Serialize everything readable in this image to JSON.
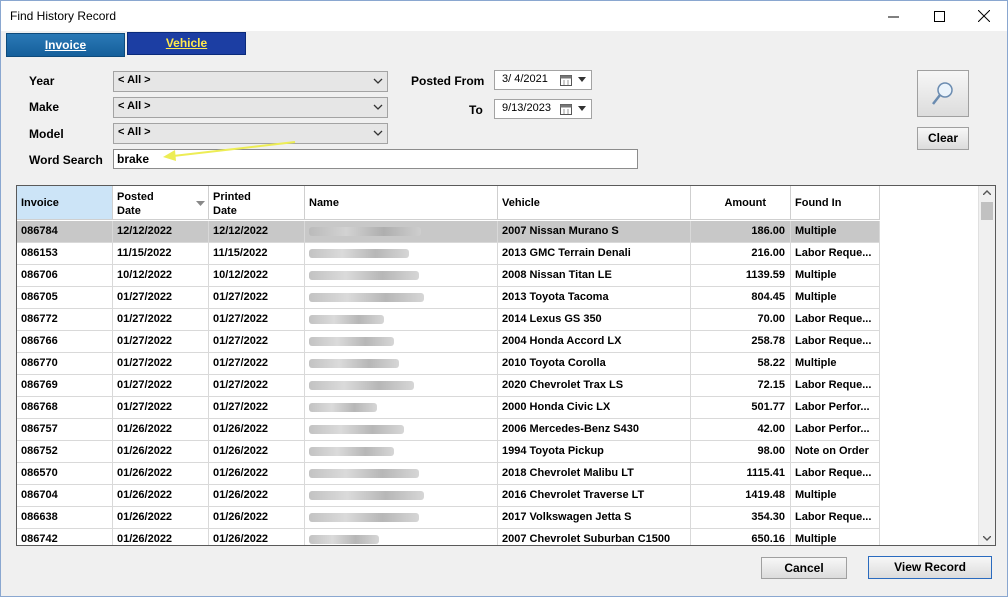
{
  "window": {
    "title": "Find History Record"
  },
  "tabs": [
    {
      "label": "Invoice",
      "active": false
    },
    {
      "label": "Vehicle",
      "active": true
    }
  ],
  "filters": {
    "year_label": "Year",
    "year_value": "< All >",
    "make_label": "Make",
    "make_value": "< All >",
    "model_label": "Model",
    "model_value": "< All >",
    "word_search_label": "Word Search",
    "word_search_value": "brake",
    "posted_from_label": "Posted From",
    "posted_from_value": "3/  4/2021",
    "to_label": "To",
    "to_value": "9/13/2023"
  },
  "buttons": {
    "clear": "Clear",
    "cancel": "Cancel",
    "view_record": "View Record"
  },
  "grid": {
    "columns": [
      {
        "key": "invoice",
        "label": "Invoice",
        "sub": ""
      },
      {
        "key": "posted",
        "label": "Posted",
        "sub": "Date"
      },
      {
        "key": "printed",
        "label": "Printed",
        "sub": "Date"
      },
      {
        "key": "name",
        "label": "Name",
        "sub": ""
      },
      {
        "key": "vehicle",
        "label": "Vehicle",
        "sub": ""
      },
      {
        "key": "amount",
        "label": "Amount",
        "sub": ""
      },
      {
        "key": "found",
        "label": "Found In",
        "sub": ""
      }
    ],
    "rows": [
      {
        "invoice": "086784",
        "posted": "12/12/2022",
        "printed": "12/12/2022",
        "vehicle": "2007 Nissan Murano S",
        "amount": "186.00",
        "found": "Multiple"
      },
      {
        "invoice": "086153",
        "posted": "11/15/2022",
        "printed": "11/15/2022",
        "vehicle": "2013 GMC Terrain Denali",
        "amount": "216.00",
        "found": "Labor Reque..."
      },
      {
        "invoice": "086706",
        "posted": "10/12/2022",
        "printed": "10/12/2022",
        "vehicle": "2008 Nissan Titan LE",
        "amount": "1139.59",
        "found": "Multiple"
      },
      {
        "invoice": "086705",
        "posted": "01/27/2022",
        "printed": "01/27/2022",
        "vehicle": "2013 Toyota Tacoma",
        "amount": "804.45",
        "found": "Multiple"
      },
      {
        "invoice": "086772",
        "posted": "01/27/2022",
        "printed": "01/27/2022",
        "vehicle": "2014 Lexus GS 350",
        "amount": "70.00",
        "found": "Labor Reque..."
      },
      {
        "invoice": "086766",
        "posted": "01/27/2022",
        "printed": "01/27/2022",
        "vehicle": "2004 Honda Accord LX",
        "amount": "258.78",
        "found": "Labor Reque..."
      },
      {
        "invoice": "086770",
        "posted": "01/27/2022",
        "printed": "01/27/2022",
        "vehicle": "2010 Toyota Corolla",
        "amount": "58.22",
        "found": "Multiple"
      },
      {
        "invoice": "086769",
        "posted": "01/27/2022",
        "printed": "01/27/2022",
        "vehicle": "2020 Chevrolet Trax LS",
        "amount": "72.15",
        "found": "Labor Reque..."
      },
      {
        "invoice": "086768",
        "posted": "01/27/2022",
        "printed": "01/27/2022",
        "vehicle": "2000 Honda Civic LX",
        "amount": "501.77",
        "found": "Labor Perfor..."
      },
      {
        "invoice": "086757",
        "posted": "01/26/2022",
        "printed": "01/26/2022",
        "vehicle": "2006 Mercedes-Benz S430",
        "amount": "42.00",
        "found": "Labor Perfor..."
      },
      {
        "invoice": "086752",
        "posted": "01/26/2022",
        "printed": "01/26/2022",
        "vehicle": "1994 Toyota Pickup",
        "amount": "98.00",
        "found": "Note on Order"
      },
      {
        "invoice": "086570",
        "posted": "01/26/2022",
        "printed": "01/26/2022",
        "vehicle": "2018 Chevrolet Malibu LT",
        "amount": "1115.41",
        "found": "Labor Reque..."
      },
      {
        "invoice": "086704",
        "posted": "01/26/2022",
        "printed": "01/26/2022",
        "vehicle": "2016 Chevrolet Traverse LT",
        "amount": "1419.48",
        "found": "Multiple"
      },
      {
        "invoice": "086638",
        "posted": "01/26/2022",
        "printed": "01/26/2022",
        "vehicle": "2017 Volkswagen Jetta S",
        "amount": "354.30",
        "found": "Labor Reque..."
      },
      {
        "invoice": "086742",
        "posted": "01/26/2022",
        "printed": "01/26/2022",
        "vehicle": "2007 Chevrolet Suburban C1500",
        "amount": "650.16",
        "found": "Multiple"
      }
    ]
  }
}
